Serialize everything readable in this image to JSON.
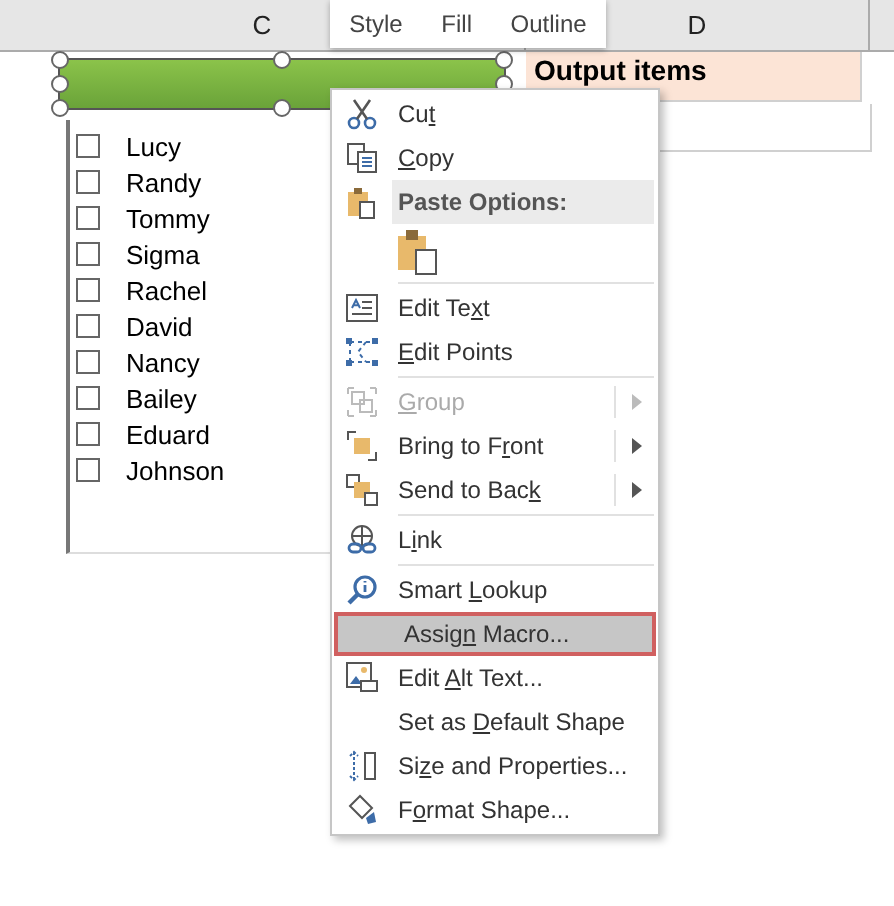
{
  "columns": [
    {
      "label": "C"
    },
    {
      "label": "D"
    }
  ],
  "mini_toolbar": {
    "buttons": [
      "Style",
      "Fill",
      "Outline"
    ]
  },
  "shape": {
    "selected": true
  },
  "listbox": {
    "items": [
      {
        "label": "Lucy",
        "checked": false
      },
      {
        "label": "Randy",
        "checked": false
      },
      {
        "label": "Tommy",
        "checked": false
      },
      {
        "label": "Sigma",
        "checked": false
      },
      {
        "label": "Rachel",
        "checked": false
      },
      {
        "label": "David",
        "checked": false
      },
      {
        "label": "Nancy",
        "checked": false
      },
      {
        "label": "Bailey",
        "checked": false
      },
      {
        "label": "Eduard",
        "checked": false
      },
      {
        "label": "Johnson",
        "checked": false
      }
    ]
  },
  "output_cell": "Output items",
  "context_menu": {
    "items": [
      {
        "kind": "item",
        "before": "Cu",
        "key": "t",
        "disabled": false,
        "selected": false,
        "submenu": false
      },
      {
        "kind": "item",
        "key": "C",
        "after": "opy",
        "disabled": false,
        "selected": false,
        "submenu": false
      },
      {
        "kind": "header",
        "text": "Paste Options:"
      },
      {
        "kind": "paste"
      },
      {
        "kind": "separator"
      },
      {
        "kind": "item",
        "before": "Edit Te",
        "key": "x",
        "after": "t",
        "disabled": false,
        "selected": false,
        "submenu": false
      },
      {
        "kind": "item",
        "key": "E",
        "after": "dit Points",
        "disabled": false,
        "selected": false,
        "submenu": false
      },
      {
        "kind": "separator"
      },
      {
        "kind": "item",
        "key": "G",
        "after": "roup",
        "disabled": true,
        "selected": false,
        "submenu": true
      },
      {
        "kind": "item",
        "before": "Bring to F",
        "key": "r",
        "after": "ont",
        "disabled": false,
        "selected": false,
        "submenu": true
      },
      {
        "kind": "item",
        "before": "Send to Bac",
        "key": "k",
        "disabled": false,
        "selected": false,
        "submenu": true
      },
      {
        "kind": "separator"
      },
      {
        "kind": "item",
        "before": "L",
        "key": "i",
        "after": "nk",
        "disabled": false,
        "selected": false,
        "submenu": false
      },
      {
        "kind": "separator"
      },
      {
        "kind": "item",
        "before": "Smart ",
        "key": "L",
        "after": "ookup",
        "disabled": false,
        "selected": false,
        "submenu": false
      },
      {
        "kind": "item",
        "before": "Assig",
        "key": "n",
        "after": " Macro...",
        "disabled": false,
        "selected": true,
        "submenu": false
      },
      {
        "kind": "item",
        "before": "Edit ",
        "key": "A",
        "after": "lt Text...",
        "disabled": false,
        "selected": false,
        "submenu": false
      },
      {
        "kind": "item",
        "before": "Set as ",
        "key": "D",
        "after": "efault Shape",
        "disabled": false,
        "selected": false,
        "submenu": false
      },
      {
        "kind": "item",
        "before": "Si",
        "key": "z",
        "after": "e and Properties...",
        "disabled": false,
        "selected": false,
        "submenu": false
      },
      {
        "kind": "item",
        "before": "F",
        "key": "o",
        "after": "rmat Shape...",
        "disabled": false,
        "selected": false,
        "submenu": false
      }
    ]
  }
}
